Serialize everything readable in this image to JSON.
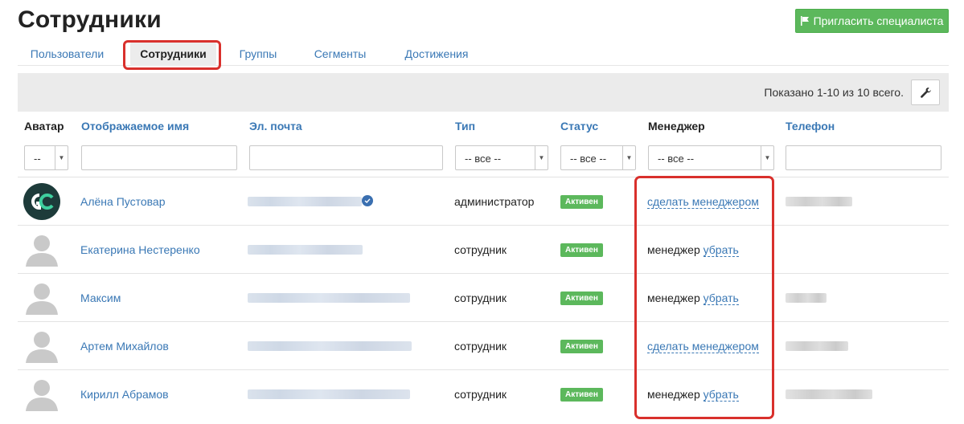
{
  "page": {
    "title": "Сотрудники"
  },
  "invite_button": {
    "label": "Пригласить специалиста",
    "icon": "flag-icon"
  },
  "tabs": [
    {
      "label": "Пользователи",
      "active": false
    },
    {
      "label": "Сотрудники",
      "active": true
    },
    {
      "label": "Группы",
      "active": false
    },
    {
      "label": "Сегменты",
      "active": false
    },
    {
      "label": "Достижения",
      "active": false
    }
  ],
  "toolbar": {
    "shown_text": "Показано 1-10 из 10 всего.",
    "settings_icon": "wrench-icon"
  },
  "columns": {
    "avatar": "Аватар",
    "name": "Отображаемое имя",
    "email": "Эл. почта",
    "type": "Тип",
    "status": "Статус",
    "manager": "Менеджер",
    "phone": "Телефон"
  },
  "filters": {
    "avatar": "--",
    "type": "-- все --",
    "status": "-- все --",
    "manager": "-- все --"
  },
  "rows": [
    {
      "name": "Алёна Пустовар",
      "avatar": "GC",
      "type": "администратор",
      "status": "Активен",
      "manager_action": "сделать менеджером",
      "manager_label": "",
      "remove_label": ""
    },
    {
      "name": "Екатерина Нестеренко",
      "avatar": "person-silhouette",
      "type": "сотрудник",
      "status": "Активен",
      "manager_action": "",
      "manager_label": "менеджер",
      "remove_label": "убрать"
    },
    {
      "name": "Максим",
      "avatar": "person-silhouette",
      "type": "сотрудник",
      "status": "Активен",
      "manager_action": "",
      "manager_label": "менеджер",
      "remove_label": "убрать"
    },
    {
      "name": "Артем Михайлов",
      "avatar": "person-silhouette",
      "type": "сотрудник",
      "status": "Активен",
      "manager_action": "сделать менеджером",
      "manager_label": "",
      "remove_label": ""
    },
    {
      "name": "Кирилл Абрамов",
      "avatar": "person-silhouette",
      "type": "сотрудник",
      "status": "Активен",
      "manager_action": "",
      "manager_label": "менеджер",
      "remove_label": "убрать"
    }
  ],
  "colors": {
    "accent": "#3a78b5",
    "success": "#5cb85c",
    "highlight": "#d9302c"
  }
}
